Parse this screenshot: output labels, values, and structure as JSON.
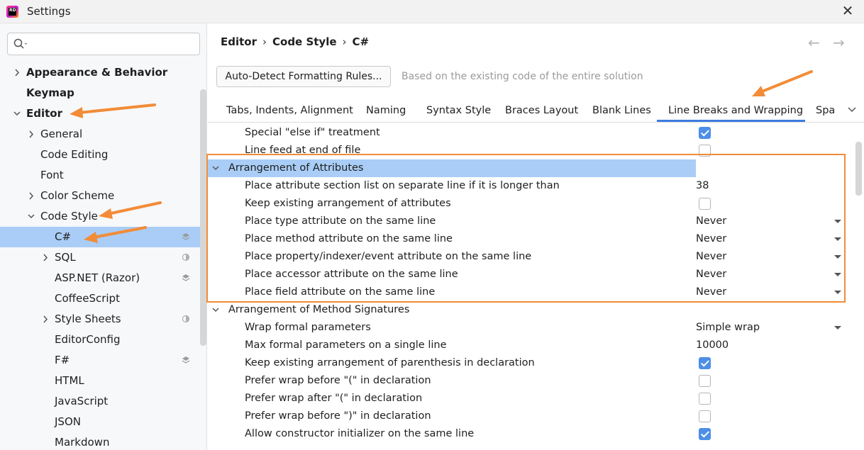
{
  "window": {
    "title": "Settings",
    "app_icon_text": "RD",
    "close_glyph": "✕"
  },
  "search": {
    "placeholder": "",
    "value": ""
  },
  "tree": [
    {
      "label": "Appearance & Behavior",
      "bold": true,
      "chevron": "right",
      "indent": 0
    },
    {
      "label": "Keymap",
      "bold": true,
      "chevron": "none",
      "indent": 0
    },
    {
      "label": "Editor",
      "bold": true,
      "chevron": "down",
      "indent": 0
    },
    {
      "label": "General",
      "bold": false,
      "chevron": "right",
      "indent": 1
    },
    {
      "label": "Code Editing",
      "bold": false,
      "chevron": "none",
      "indent": 1
    },
    {
      "label": "Font",
      "bold": false,
      "chevron": "none",
      "indent": 1
    },
    {
      "label": "Color Scheme",
      "bold": false,
      "chevron": "right",
      "indent": 1
    },
    {
      "label": "Code Style",
      "bold": false,
      "chevron": "down",
      "indent": 1
    },
    {
      "label": "C#",
      "bold": false,
      "chevron": "none",
      "indent": 2,
      "selected": true,
      "badge": "layers"
    },
    {
      "label": "SQL",
      "bold": false,
      "chevron": "right",
      "indent": 2,
      "badge": "half"
    },
    {
      "label": "ASP.NET (Razor)",
      "bold": false,
      "chevron": "none",
      "indent": 2,
      "badge": "layers"
    },
    {
      "label": "CoffeeScript",
      "bold": false,
      "chevron": "none",
      "indent": 2
    },
    {
      "label": "Style Sheets",
      "bold": false,
      "chevron": "right",
      "indent": 2,
      "badge": "half"
    },
    {
      "label": "EditorConfig",
      "bold": false,
      "chevron": "none",
      "indent": 2
    },
    {
      "label": "F#",
      "bold": false,
      "chevron": "none",
      "indent": 2,
      "badge": "layers"
    },
    {
      "label": "HTML",
      "bold": false,
      "chevron": "none",
      "indent": 2
    },
    {
      "label": "JavaScript",
      "bold": false,
      "chevron": "none",
      "indent": 2
    },
    {
      "label": "JSON",
      "bold": false,
      "chevron": "none",
      "indent": 2
    },
    {
      "label": "Markdown",
      "bold": false,
      "chevron": "none",
      "indent": 2
    }
  ],
  "breadcrumb": {
    "items": [
      "Editor",
      "Code Style",
      "C#"
    ],
    "separator": "›"
  },
  "nav": {
    "back": "←",
    "forward": "→"
  },
  "auto_detect": {
    "button_label": "Auto-Detect Formatting Rules...",
    "hint": "Based on the existing code of the entire solution"
  },
  "tabs": [
    {
      "label": "Tabs, Indents, Alignment",
      "active": false
    },
    {
      "label": "Naming",
      "active": false
    },
    {
      "label": "Syntax Style",
      "active": false
    },
    {
      "label": "Braces Layout",
      "active": false
    },
    {
      "label": "Blank Lines",
      "active": false
    },
    {
      "label": "Line Breaks and Wrapping",
      "active": true
    },
    {
      "label": "Spa",
      "active": false
    }
  ],
  "tab_overflow_glyph": "⌄",
  "settings": [
    {
      "type": "item",
      "label": "Special \"else if\" treatment",
      "control": "checkbox",
      "checked": true
    },
    {
      "type": "item",
      "label": "Line feed at end of file",
      "control": "checkbox",
      "checked": false
    },
    {
      "type": "group",
      "label": "Arrangement of Attributes",
      "expanded": true,
      "highlighted": true
    },
    {
      "type": "item",
      "label": "Place attribute section list on separate line if it is longer than",
      "control": "number",
      "value": "38"
    },
    {
      "type": "item",
      "label": "Keep existing arrangement of attributes",
      "control": "checkbox",
      "checked": false
    },
    {
      "type": "item",
      "label": "Place type attribute on the same line",
      "control": "dropdown",
      "value": "Never"
    },
    {
      "type": "item",
      "label": "Place method attribute on the same line",
      "control": "dropdown",
      "value": "Never"
    },
    {
      "type": "item",
      "label": "Place property/indexer/event attribute on the same line",
      "control": "dropdown",
      "value": "Never"
    },
    {
      "type": "item",
      "label": "Place accessor attribute on the same line",
      "control": "dropdown",
      "value": "Never"
    },
    {
      "type": "item",
      "label": "Place field attribute on the same line",
      "control": "dropdown",
      "value": "Never"
    },
    {
      "type": "group",
      "label": "Arrangement of Method Signatures",
      "expanded": true,
      "highlighted": false
    },
    {
      "type": "item",
      "label": "Wrap formal parameters",
      "control": "dropdown",
      "value": "Simple wrap"
    },
    {
      "type": "item",
      "label": "Max formal parameters on a single line",
      "control": "number",
      "value": "10000"
    },
    {
      "type": "item",
      "label": "Keep existing arrangement of parenthesis in declaration",
      "control": "checkbox",
      "checked": true
    },
    {
      "type": "item",
      "label": "Prefer wrap before \"(\" in declaration",
      "control": "checkbox",
      "checked": false
    },
    {
      "type": "item",
      "label": "Prefer wrap after \"(\" in declaration",
      "control": "checkbox",
      "checked": false
    },
    {
      "type": "item",
      "label": "Prefer wrap before \")\" in declaration",
      "control": "checkbox",
      "checked": false
    },
    {
      "type": "item",
      "label": "Allow constructor initializer on the same line",
      "control": "checkbox",
      "checked": true
    }
  ],
  "colors": {
    "selection": "#a9cdf6",
    "accent": "#4d8ee8",
    "annotation": "#f28c38"
  }
}
